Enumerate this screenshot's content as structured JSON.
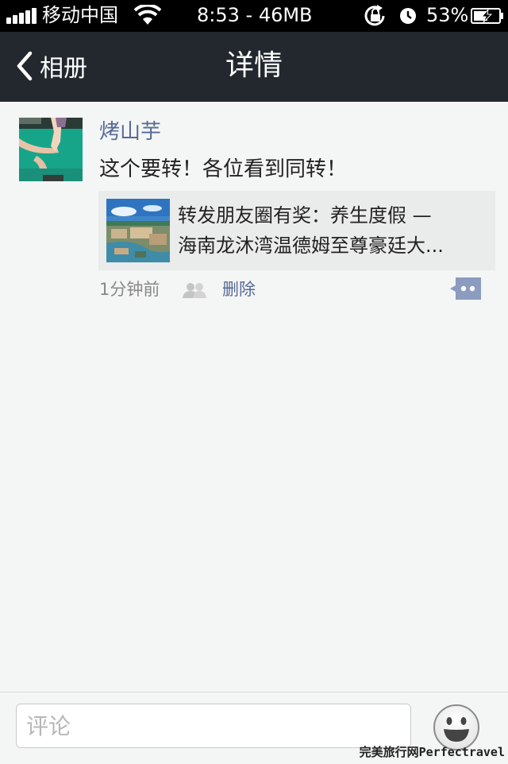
{
  "status_bar": {
    "carrier": "移动中国",
    "time_info": "8:53 - 46MB",
    "battery": "53%",
    "icons": [
      "signal-icon",
      "wifi-icon",
      "rotation-lock-icon",
      "alarm-icon",
      "battery-charging-icon"
    ]
  },
  "nav": {
    "back_label": "相册",
    "title": "详情"
  },
  "post": {
    "author": "烤山芋",
    "text": "这个要转！各位看到同转！",
    "shared_link": {
      "title_line1": "转发朋友圈有奖：养生度假 —",
      "title_line2": "海南龙沐湾温德姆至尊豪廷大..."
    },
    "time": "1分钟前",
    "delete_label": "删除"
  },
  "comment_bar": {
    "placeholder": "评论"
  },
  "watermark": "完美旅行网Perfectravel",
  "colors": {
    "nav_background": "#22282d",
    "link_blue": "#556a95",
    "page_background": "#f4f5f5",
    "card_background": "#eaebeb"
  }
}
